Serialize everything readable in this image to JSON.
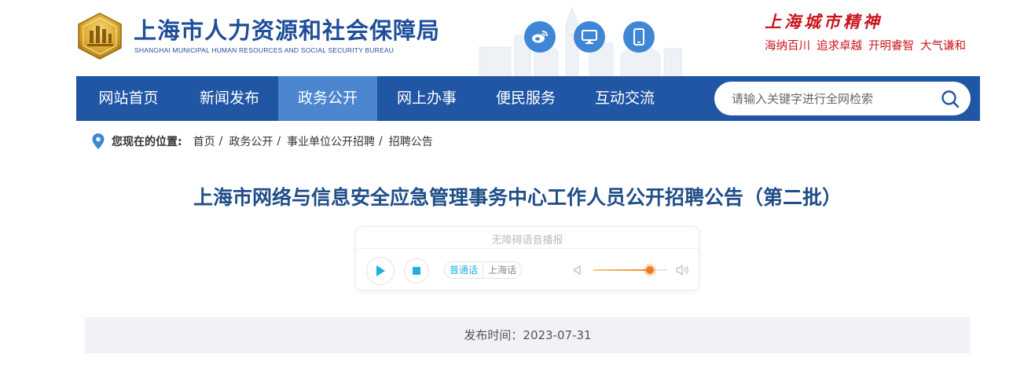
{
  "header": {
    "site_name": "上海市人力资源和社会保障局",
    "site_name_en": "SHANGHAI MUNICIPAL HUMAN RESOURCES AND SOCIAL SECURITY BUREAU",
    "icons": [
      "weibo-icon",
      "monitor-icon",
      "mobile-icon"
    ],
    "spirit_title": "上海城市精神",
    "spirit_words": [
      "海纳百川",
      "追求卓越",
      "开明睿智",
      "大气谦和"
    ]
  },
  "nav": {
    "items": [
      {
        "label": "网站首页",
        "active": false
      },
      {
        "label": "新闻发布",
        "active": false
      },
      {
        "label": "政务公开",
        "active": true
      },
      {
        "label": "网上办事",
        "active": false
      },
      {
        "label": "便民服务",
        "active": false
      },
      {
        "label": "互动交流",
        "active": false
      }
    ],
    "search_placeholder": "请输入关键字进行全网检索"
  },
  "breadcrumb": {
    "label": "您现在的位置:",
    "items": [
      "首页",
      "政务公开",
      "事业单位公开招聘",
      "招聘公告"
    ],
    "separator": "/"
  },
  "article": {
    "title": "上海市网络与信息安全应急管理事务中心工作人员公开招聘公告（第二批）",
    "publish_label": "发布时间：",
    "publish_date": "2023-07-31"
  },
  "player": {
    "title": "无障碍语音播报",
    "languages": [
      "普通话",
      "上海话"
    ],
    "selected_language": "普通话",
    "volume": 0.77
  },
  "colors": {
    "brand_blue": "#2156a5",
    "nav_active": "#4b86cf",
    "title_blue": "#1f4e89",
    "spirit_red": "#c8161d",
    "accent_orange": "#ef7d1c"
  }
}
